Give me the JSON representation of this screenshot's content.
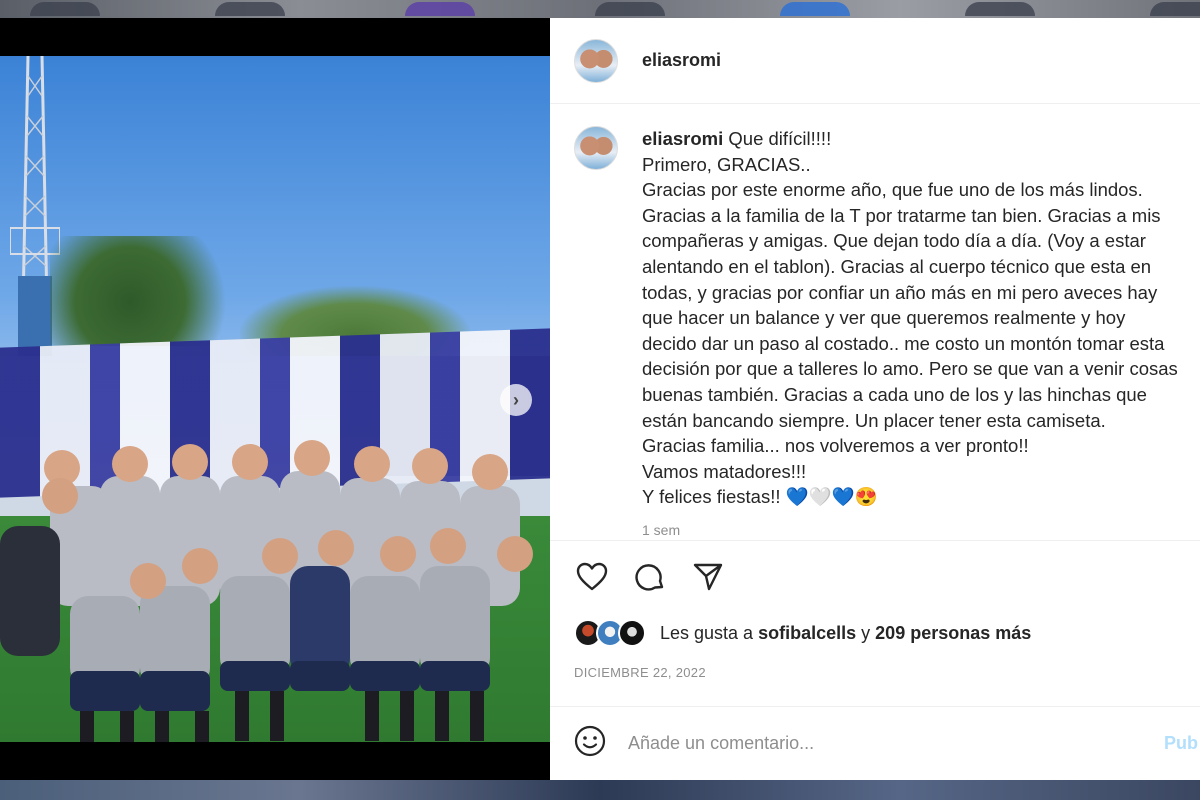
{
  "post": {
    "username": "eliasromi",
    "caption_lines": [
      "Que difícil!!!!",
      "Primero, GRACIAS..",
      "Gracias por este enorme año, que fue uno de los más lindos.",
      "Gracias a la familia de la T por tratarme tan bien. Gracias a mis",
      "compañeras y amigas. Que dejan todo día a día. (Voy a estar",
      "alentando en el tablon). Gracias al cuerpo técnico que esta en",
      "todas, y gracias por confiar un año más en mi pero aveces hay",
      "que hacer un balance y ver que queremos realmente y hoy",
      "decido dar un paso al costado.. me costo un montón tomar esta",
      "decisión por que a talleres lo amo. Pero se que van a venir cosas",
      "buenas también. Gracias a cada uno de los y las hinchas que",
      "están bancando siempre. Un placer tener esta camiseta.",
      "Gracias familia... nos volveremos a ver pronto!!",
      "Vamos matadores!!!",
      "Y felices fiestas!!"
    ],
    "caption_emojis": [
      "💙",
      "🤍",
      "💙",
      "😍"
    ],
    "time_ago": "1 sem",
    "likes_prefix": "Les gusta a",
    "likes_user": "sofibalcells",
    "likes_joiner": "y",
    "likes_count_text": "209 personas más",
    "date": "DICIEMBRE 22, 2022"
  },
  "comment": {
    "placeholder": "Añade un comentario...",
    "publish_label": "Pub"
  },
  "icons": {
    "carousel_next": "chevron-right-icon",
    "like": "heart-icon",
    "comment": "comment-icon",
    "share": "share-icon",
    "emoji": "emoji-icon"
  },
  "colors": {
    "text": "#262626",
    "muted": "#8e8e8e",
    "publish": "#b2dffc",
    "border": "#efefef"
  }
}
